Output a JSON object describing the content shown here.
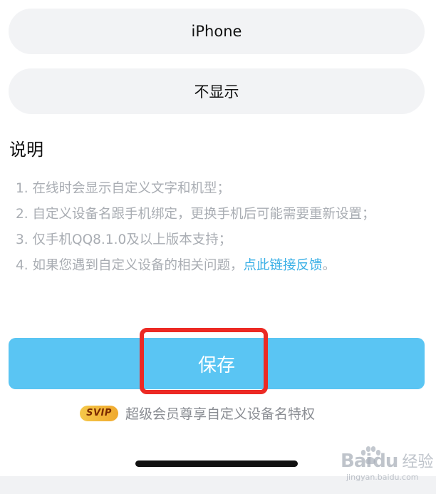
{
  "options": {
    "device_name": "iPhone",
    "hide_option": "不显示"
  },
  "description": {
    "title": "说明",
    "note_1": "1. 在线时会显示自定义文字和机型；",
    "note_2": "2. 自定义设备名跟手机绑定，更换手机后可能需要重新设置；",
    "note_3": "3. 仅手机QQ8.1.0及以上版本支持；",
    "note_4_prefix": "4. 如果您遇到自定义设备的相关问题，",
    "note_4_link": "点此链接反馈",
    "note_4_suffix": "。"
  },
  "actions": {
    "save_label": "保存"
  },
  "svip": {
    "badge": "SVIP",
    "text": "超级会员尊享自定义设备名特权"
  },
  "watermark": {
    "brand": "Bai",
    "brand_suffix": "du",
    "brand_cn": "经验",
    "url": "jingyan.baidu.com"
  },
  "colors": {
    "accent": "#5ac5f3",
    "link": "#3bb0e6",
    "highlight": "#ec2a24",
    "pill_background": "#f2f3f5"
  }
}
